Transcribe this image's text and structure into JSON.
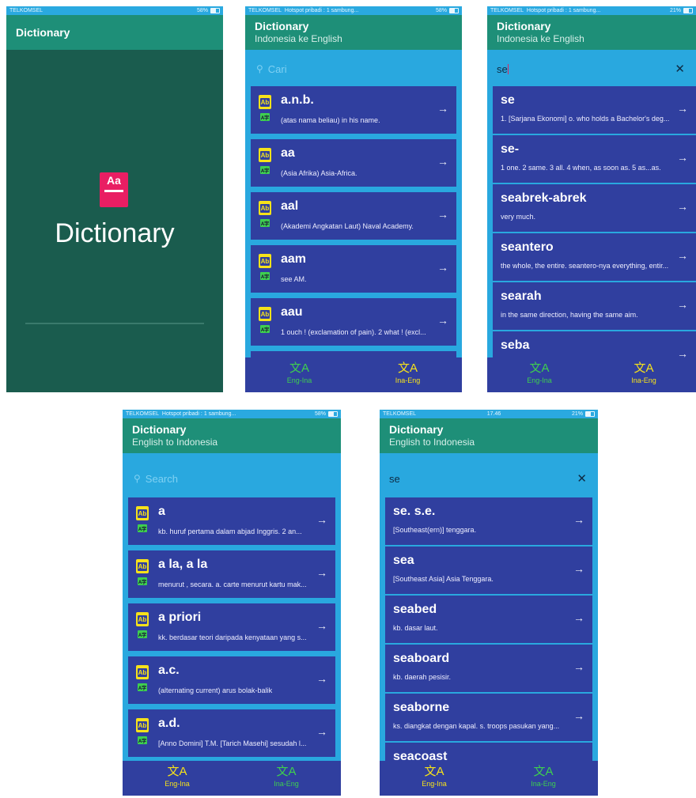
{
  "screens": [
    {
      "status": {
        "carrier": "TELKOMSEL",
        "hotspot": "",
        "time": "",
        "battery": "58%"
      },
      "title": "Dictionary",
      "splash_name": "Dictionary"
    },
    {
      "status": {
        "carrier": "TELKOMSEL",
        "hotspot": "Hotspot pribadi : 1 sambung...",
        "time": "",
        "battery": "58%"
      },
      "title": "Dictionary",
      "subtitle": "Indonesia ke English",
      "search": {
        "placeholder": "Cari",
        "value": ""
      },
      "entries": [
        {
          "word": "a.n.b.",
          "def": "(atas nama beliau) in his name."
        },
        {
          "word": "aa",
          "def": "(Asia Afrika)  Asia-Africa."
        },
        {
          "word": "aal",
          "def": "(Akademi Angkatan Laut) Naval Academy."
        },
        {
          "word": "aam",
          "def": "see AM."
        },
        {
          "word": "aau",
          "def": "1 ouch ! (exclamation of pain). 2 what ! (excl..."
        }
      ],
      "nav": {
        "eng_ina": "Eng-Ina",
        "ina_eng": "Ina-Eng"
      }
    },
    {
      "status": {
        "carrier": "TELKOMSEL",
        "hotspot": "Hotspot pribadi : 1 sambung...",
        "time": "",
        "battery": "21%"
      },
      "title": "Dictionary",
      "subtitle": "Indonesia ke English",
      "search": {
        "placeholder": "",
        "value": "se"
      },
      "entries": [
        {
          "word": "se",
          "def": "1. [Sarjana Ekonomi] o. who holds a Bachelor's deg..."
        },
        {
          "word": "se-",
          "def": "1 one. 2 same. 3 all. 4 when, as soon as. 5 as...as."
        },
        {
          "word": "seabrek-abrek",
          "def": "very much."
        },
        {
          "word": "seantero",
          "def": "the whole, the entire. seantero-nya everything, entir..."
        },
        {
          "word": "searah",
          "def": "in the same direction, having the same aim."
        },
        {
          "word": "seba",
          "def": ""
        }
      ],
      "nav": {
        "eng_ina": "Eng-Ina",
        "ina_eng": "Ina-Eng"
      }
    },
    {
      "status": {
        "carrier": "TELKOMSEL",
        "hotspot": "Hotspot pribadi : 1 sambung...",
        "time": "",
        "battery": "58%"
      },
      "title": "Dictionary",
      "subtitle": "English to Indonesia",
      "search": {
        "placeholder": "Search",
        "value": ""
      },
      "entries": [
        {
          "word": "a",
          "def": "kb. huruf pertama dalam abjad Inggris. 2 an..."
        },
        {
          "word": "a la, a la",
          "def": "menurut , secara. a. carte menurut kartu mak..."
        },
        {
          "word": "a priori",
          "def": "kk. berdasar teori daripada kenyataan yang s..."
        },
        {
          "word": "a.c.",
          "def": "(alternating current) arus bolak-balik"
        },
        {
          "word": "a.d.",
          "def": "[Anno Domini] T.M. [Tarich Masehi] sesudah l..."
        }
      ],
      "nav": {
        "eng_ina": "Eng-Ina",
        "ina_eng": "Ina-Eng"
      }
    },
    {
      "status": {
        "carrier": "TELKOMSEL",
        "hotspot": "",
        "time": "17.46",
        "battery": "21%"
      },
      "title": "Dictionary",
      "subtitle": "English to Indonesia",
      "search": {
        "placeholder": "",
        "value": "se"
      },
      "entries": [
        {
          "word": "se. s.e.",
          "def": "[Southeast(ern)] tenggara."
        },
        {
          "word": "sea",
          "def": "[Southeast Asia] Asia Tenggara."
        },
        {
          "word": "seabed",
          "def": "kb. dasar laut."
        },
        {
          "word": "seaboard",
          "def": "kb. daerah pesisir."
        },
        {
          "word": "seaborne",
          "def": "ks. diangkat dengan kapal. s. troops pasukan yang..."
        },
        {
          "word": "seacoast",
          "def": ""
        }
      ],
      "nav": {
        "eng_ina": "Eng-Ina",
        "ina_eng": "Ina-Eng"
      }
    }
  ],
  "icons": {
    "search": "search-icon",
    "arrow": "arrow-right-icon",
    "close": "close-icon",
    "translate": "translate-icon"
  },
  "colors": {
    "appbar": "#1e8f78",
    "status": "#2aa9e0",
    "card": "#303f9f",
    "accent_yellow": "#f6e21a",
    "accent_green": "#3ecf4f",
    "splash_bg": "#1a5c4e",
    "logo": "#e91e63"
  }
}
